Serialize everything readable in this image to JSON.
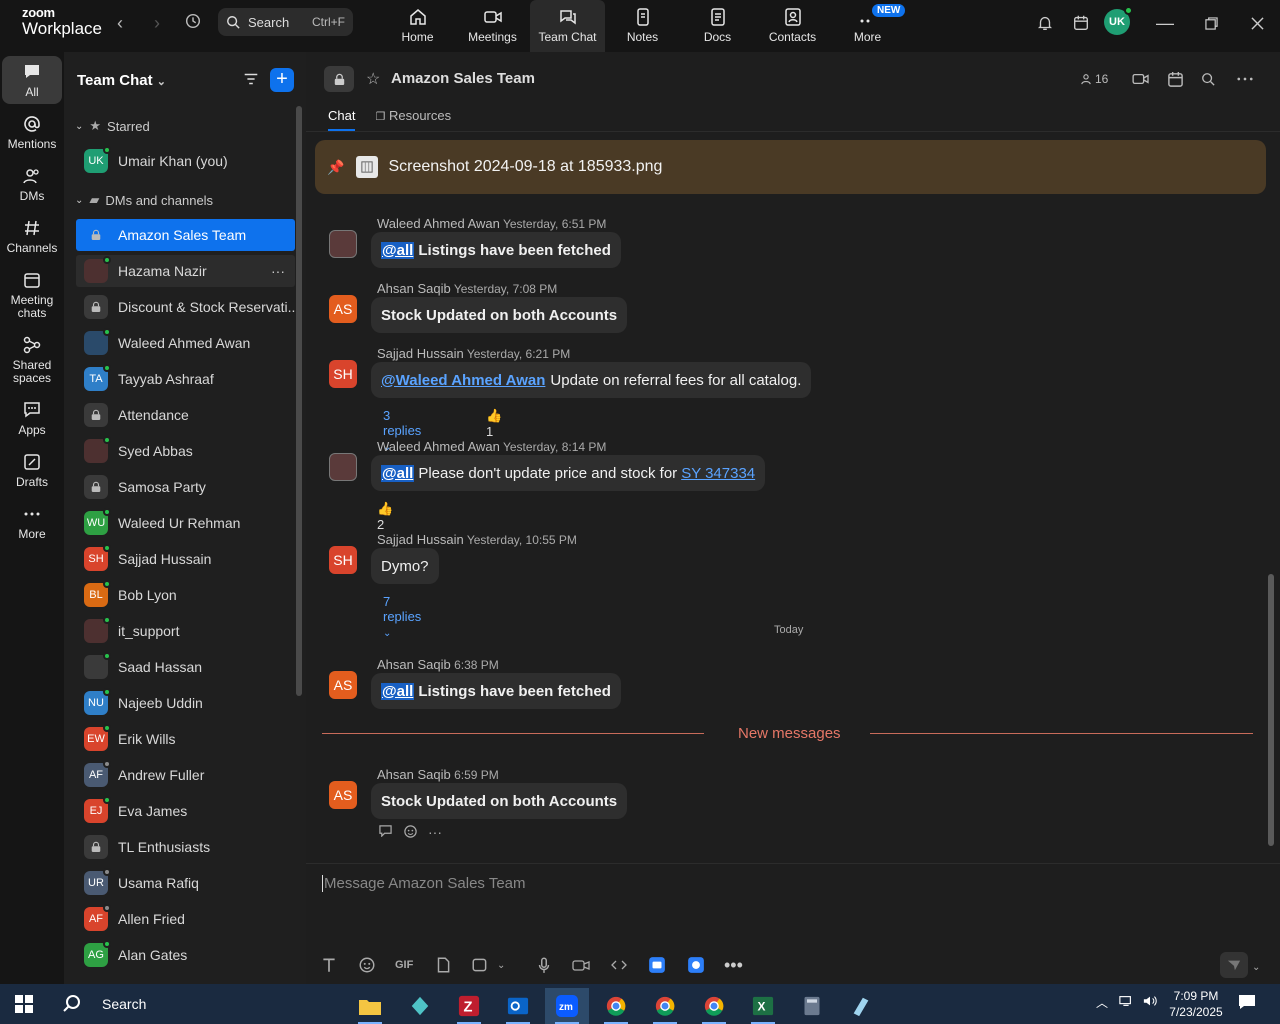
{
  "app": {
    "logo_line1": "zoom",
    "logo_line2": "Workplace",
    "search_label": "Search",
    "search_shortcut": "Ctrl+F",
    "user_initials": "UK"
  },
  "topnav": [
    {
      "label": "Home",
      "icon": "home-icon"
    },
    {
      "label": "Meetings",
      "icon": "video-icon"
    },
    {
      "label": "Team Chat",
      "icon": "chat-icon",
      "active": true
    },
    {
      "label": "Notes",
      "icon": "notes-icon"
    },
    {
      "label": "Docs",
      "icon": "docs-icon"
    },
    {
      "label": "Contacts",
      "icon": "contacts-icon"
    },
    {
      "label": "More",
      "icon": "more-icon",
      "badge": "NEW"
    }
  ],
  "rail": [
    {
      "label": "All",
      "active": true
    },
    {
      "label": "Mentions"
    },
    {
      "label": "DMs"
    },
    {
      "label": "Channels"
    },
    {
      "label": "Meeting chats"
    },
    {
      "label": "Shared spaces"
    },
    {
      "label": "Apps"
    },
    {
      "label": "Drafts"
    },
    {
      "label": "More"
    }
  ],
  "sidebar": {
    "title": "Team Chat",
    "starred_label": "Starred",
    "dms_label": "DMs and channels",
    "starred": [
      {
        "name": "Umair Khan (you)",
        "initials": "UK",
        "color": "#1f9e73"
      }
    ],
    "items": [
      {
        "name": "Amazon Sales Team",
        "type": "locked",
        "selected": true
      },
      {
        "name": "Hazama Nazir",
        "type": "photo",
        "hover": true
      },
      {
        "name": "Discount & Stock Reservati...",
        "type": "locked"
      },
      {
        "name": "Waleed Ahmed Awan",
        "type": "photo"
      },
      {
        "name": "Tayyab Ashraaf",
        "initials": "TA",
        "color": "#2f7fc8"
      },
      {
        "name": "Attendance",
        "type": "locked"
      },
      {
        "name": "Syed Abbas",
        "type": "photo"
      },
      {
        "name": "Samosa Party",
        "type": "locked"
      },
      {
        "name": "Waleed Ur Rehman",
        "initials": "WU",
        "color": "#2ea043"
      },
      {
        "name": "Sajjad Hussain",
        "initials": "SH",
        "color": "#d9442c"
      },
      {
        "name": "Bob Lyon",
        "initials": "BL",
        "color": "#d96a13"
      },
      {
        "name": "it_support",
        "type": "photo"
      },
      {
        "name": "Saad Hassan",
        "type": "photo"
      },
      {
        "name": "Najeeb Uddin",
        "initials": "NU",
        "color": "#2f7fc8"
      },
      {
        "name": "Erik Wills",
        "initials": "EW",
        "color": "#d9442c"
      },
      {
        "name": "Andrew Fuller",
        "initials": "AF",
        "color": "#4a5a72"
      },
      {
        "name": "Eva James",
        "initials": "EJ",
        "color": "#d9442c"
      },
      {
        "name": "TL Enthusiasts",
        "type": "locked"
      },
      {
        "name": "Usama Rafiq",
        "initials": "UR",
        "color": "#4a5a72"
      },
      {
        "name": "Allen Fried",
        "initials": "AF",
        "color": "#d9442c"
      },
      {
        "name": "Alan Gates",
        "initials": "AG",
        "color": "#2ea043"
      }
    ]
  },
  "channel": {
    "title": "Amazon Sales Team",
    "member_count": "16",
    "tabs": [
      "Chat",
      "Resources"
    ],
    "pinned_file": "Screenshot 2024-09-18 at 185933.png",
    "today_label": "Today",
    "new_messages_label": "New messages",
    "composer_placeholder": "Message Amazon Sales Team"
  },
  "messages": [
    {
      "author": "Waleed Ahmed Awan",
      "time": "Yesterday, 6:51 PM",
      "at_all": "@all",
      "text": "Listings have been fetched"
    },
    {
      "author": "Ahsan Saqib",
      "initials": "AS",
      "time": "Yesterday, 7:08 PM",
      "text": "Stock Updated on both Accounts"
    },
    {
      "author": "Sajjad Hussain",
      "initials": "SH",
      "time": "Yesterday, 6:21 PM",
      "mention": "@Waleed Ahmed Awan",
      "text": "Update on referral fees for all catalog.",
      "replies": "3 replies",
      "reaction": "1"
    },
    {
      "author": "Waleed Ahmed Awan",
      "time": "Yesterday, 8:14 PM",
      "at_all": "@all",
      "text": "Please don't update price and stock for",
      "link": "SY 347334",
      "reaction": "2"
    },
    {
      "author": "Sajjad Hussain",
      "initials": "SH",
      "time": "Yesterday, 10:55 PM",
      "text": "Dymo?",
      "replies": "7 replies"
    },
    {
      "author": "Ahsan Saqib",
      "initials": "AS",
      "time": "6:38 PM",
      "at_all": "@all",
      "text": "Listings have been fetched"
    },
    {
      "author": "Ahsan Saqib",
      "initials": "AS",
      "time": "6:59 PM",
      "text": "Stock Updated on both Accounts"
    }
  ],
  "taskbar": {
    "search_label": "Search",
    "time": "7:09 PM",
    "date": "7/23/2025"
  },
  "colors": {
    "accent": "#0e72ed",
    "orange_avatar": "#e35d1e",
    "red_avatar": "#d9442c",
    "pinned_bg": "#4a3a25"
  }
}
